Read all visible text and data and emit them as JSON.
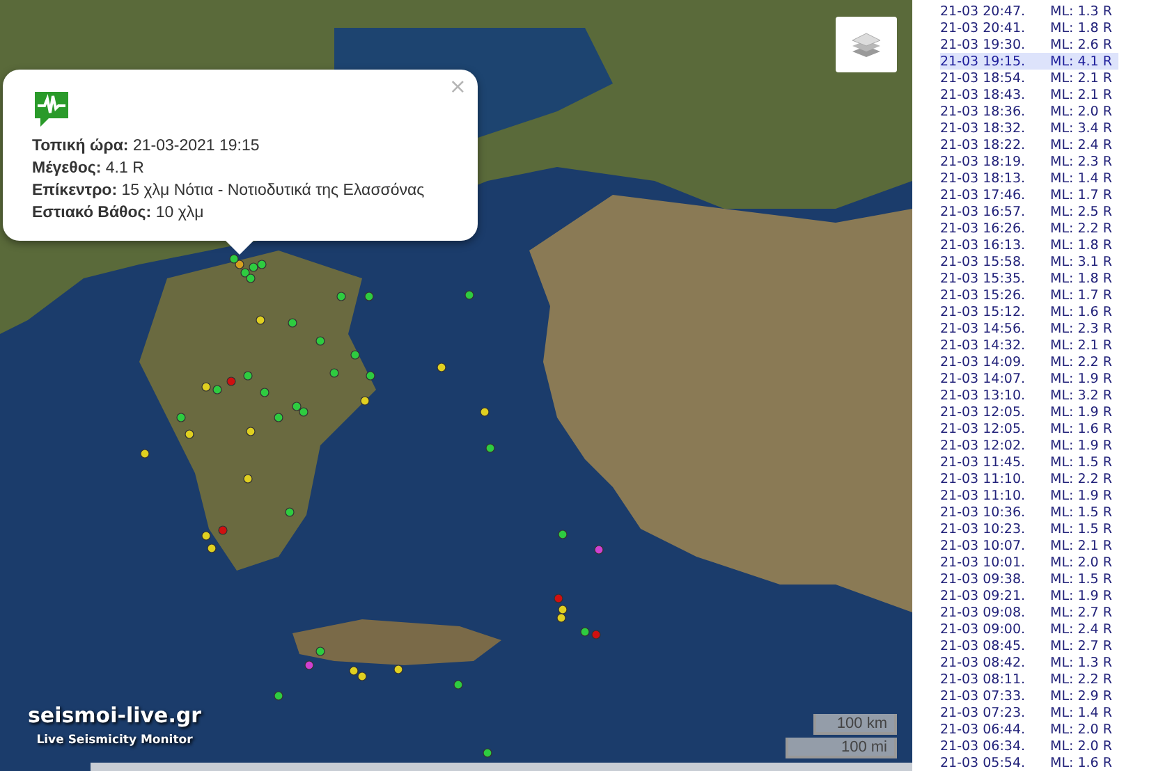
{
  "popup": {
    "close": "×",
    "fields": [
      {
        "label": "Τοπική ώρα:",
        "value": "21-03-2021 19:15"
      },
      {
        "label": "Μέγεθος:",
        "value": "4.1 R"
      },
      {
        "label": "Επίκεντρο:",
        "value": "15 χλμ Νότια - Νοτιοδυτικά της Ελασσόνας"
      },
      {
        "label": "Εστιακό Βάθος:",
        "value": "10 χλμ"
      }
    ]
  },
  "logo": {
    "title": "seismoi-live.gr",
    "subtitle": "Live Seismicity Monitor"
  },
  "scale": [
    "100 km",
    "100 mi"
  ],
  "events": [
    {
      "time": "21-03 20:47.",
      "magnitude": "ML: 1.3 R",
      "selected": false
    },
    {
      "time": "21-03 20:41.",
      "magnitude": "ML: 1.8 R",
      "selected": false
    },
    {
      "time": "21-03 19:30.",
      "magnitude": "ML: 2.6 R",
      "selected": false
    },
    {
      "time": "21-03 19:15.",
      "magnitude": "ML: 4.1 R",
      "selected": true
    },
    {
      "time": "21-03 18:54.",
      "magnitude": "ML: 2.1 R",
      "selected": false
    },
    {
      "time": "21-03 18:43.",
      "magnitude": "ML: 2.1 R",
      "selected": false
    },
    {
      "time": "21-03 18:36.",
      "magnitude": "ML: 2.0 R",
      "selected": false
    },
    {
      "time": "21-03 18:32.",
      "magnitude": "ML: 3.4 R",
      "selected": false
    },
    {
      "time": "21-03 18:22.",
      "magnitude": "ML: 2.4 R",
      "selected": false
    },
    {
      "time": "21-03 18:19.",
      "magnitude": "ML: 2.3 R",
      "selected": false
    },
    {
      "time": "21-03 18:13.",
      "magnitude": "ML: 1.4 R",
      "selected": false
    },
    {
      "time": "21-03 17:46.",
      "magnitude": "ML: 1.7 R",
      "selected": false
    },
    {
      "time": "21-03 16:57.",
      "magnitude": "ML: 2.5 R",
      "selected": false
    },
    {
      "time": "21-03 16:26.",
      "magnitude": "ML: 2.2 R",
      "selected": false
    },
    {
      "time": "21-03 16:13.",
      "magnitude": "ML: 1.8 R",
      "selected": false
    },
    {
      "time": "21-03 15:58.",
      "magnitude": "ML: 3.1 R",
      "selected": false
    },
    {
      "time": "21-03 15:35.",
      "magnitude": "ML: 1.8 R",
      "selected": false
    },
    {
      "time": "21-03 15:26.",
      "magnitude": "ML: 1.7 R",
      "selected": false
    },
    {
      "time": "21-03 15:12.",
      "magnitude": "ML: 1.6 R",
      "selected": false
    },
    {
      "time": "21-03 14:56.",
      "magnitude": "ML: 2.3 R",
      "selected": false
    },
    {
      "time": "21-03 14:32.",
      "magnitude": "ML: 2.1 R",
      "selected": false
    },
    {
      "time": "21-03 14:09.",
      "magnitude": "ML: 2.2 R",
      "selected": false
    },
    {
      "time": "21-03 14:07.",
      "magnitude": "ML: 1.9 R",
      "selected": false
    },
    {
      "time": "21-03 13:10.",
      "magnitude": "ML: 3.2 R",
      "selected": false
    },
    {
      "time": "21-03 12:05.",
      "magnitude": "ML: 1.9 R",
      "selected": false
    },
    {
      "time": "21-03 12:05.",
      "magnitude": "ML: 1.6 R",
      "selected": false
    },
    {
      "time": "21-03 12:02.",
      "magnitude": "ML: 1.9 R",
      "selected": false
    },
    {
      "time": "21-03 11:45.",
      "magnitude": "ML: 1.5 R",
      "selected": false
    },
    {
      "time": "21-03 11:10.",
      "magnitude": "ML: 2.2 R",
      "selected": false
    },
    {
      "time": "21-03 11:10.",
      "magnitude": "ML: 1.9 R",
      "selected": false
    },
    {
      "time": "21-03 10:36.",
      "magnitude": "ML: 1.5 R",
      "selected": false
    },
    {
      "time": "21-03 10:23.",
      "magnitude": "ML: 1.5 R",
      "selected": false
    },
    {
      "time": "21-03 10:07.",
      "magnitude": "ML: 2.1 R",
      "selected": false
    },
    {
      "time": "21-03 10:01.",
      "magnitude": "ML: 2.0 R",
      "selected": false
    },
    {
      "time": "21-03 09:38.",
      "magnitude": "ML: 1.5 R",
      "selected": false
    },
    {
      "time": "21-03 09:21.",
      "magnitude": "ML: 1.9 R",
      "selected": false
    },
    {
      "time": "21-03 09:08.",
      "magnitude": "ML: 2.7 R",
      "selected": false
    },
    {
      "time": "21-03 09:00.",
      "magnitude": "ML: 2.4 R",
      "selected": false
    },
    {
      "time": "21-03 08:45.",
      "magnitude": "ML: 2.7 R",
      "selected": false
    },
    {
      "time": "21-03 08:42.",
      "magnitude": "ML: 1.3 R",
      "selected": false
    },
    {
      "time": "21-03 08:11.",
      "magnitude": "ML: 2.2 R",
      "selected": false
    },
    {
      "time": "21-03 07:33.",
      "magnitude": "ML: 2.9 R",
      "selected": false
    },
    {
      "time": "21-03 07:23.",
      "magnitude": "ML: 1.4 R",
      "selected": false
    },
    {
      "time": "21-03 06:44.",
      "magnitude": "ML: 2.0 R",
      "selected": false
    },
    {
      "time": "21-03 06:34.",
      "magnitude": "ML: 2.0 R",
      "selected": false
    },
    {
      "time": "21-03 05:54.",
      "magnitude": "ML: 1.6 R",
      "selected": false
    }
  ]
}
